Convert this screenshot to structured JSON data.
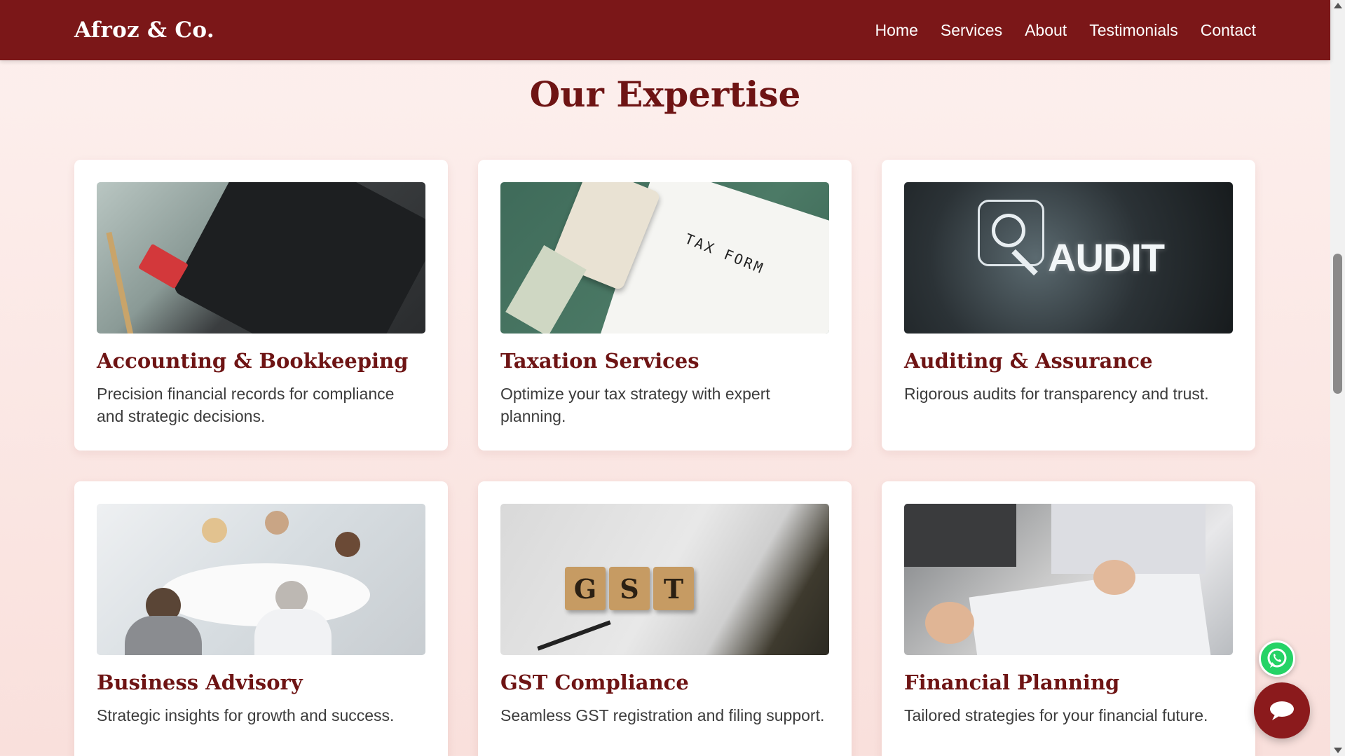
{
  "nav": {
    "brand": "Afroz & Co.",
    "links": [
      "Home",
      "Services",
      "About",
      "Testimonials",
      "Contact"
    ]
  },
  "section": {
    "title": "Our Expertise"
  },
  "cards": [
    {
      "title": "Accounting & Bookkeeping",
      "desc": "Precision financial records for compliance and strategic decisions."
    },
    {
      "title": "Taxation Services",
      "desc": "Optimize your tax strategy with expert planning."
    },
    {
      "title": "Auditing & Assurance",
      "desc": "Rigorous audits for transparency and trust."
    },
    {
      "title": "Business Advisory",
      "desc": "Strategic insights for growth and success."
    },
    {
      "title": "GST Compliance",
      "desc": "Seamless GST registration and filing support."
    },
    {
      "title": "Financial Planning",
      "desc": "Tailored strategies for your financial future."
    }
  ],
  "image_text": {
    "audit": "AUDIT",
    "tax_form": "TAX FORM",
    "gst_tiles": [
      "G",
      "S",
      "T"
    ]
  },
  "icons": {
    "whatsapp": "whatsapp-icon",
    "chat": "chat-bubble-icon"
  },
  "colors": {
    "brand": "#7b1718",
    "title": "#6e1414",
    "whatsapp": "#25d366"
  }
}
